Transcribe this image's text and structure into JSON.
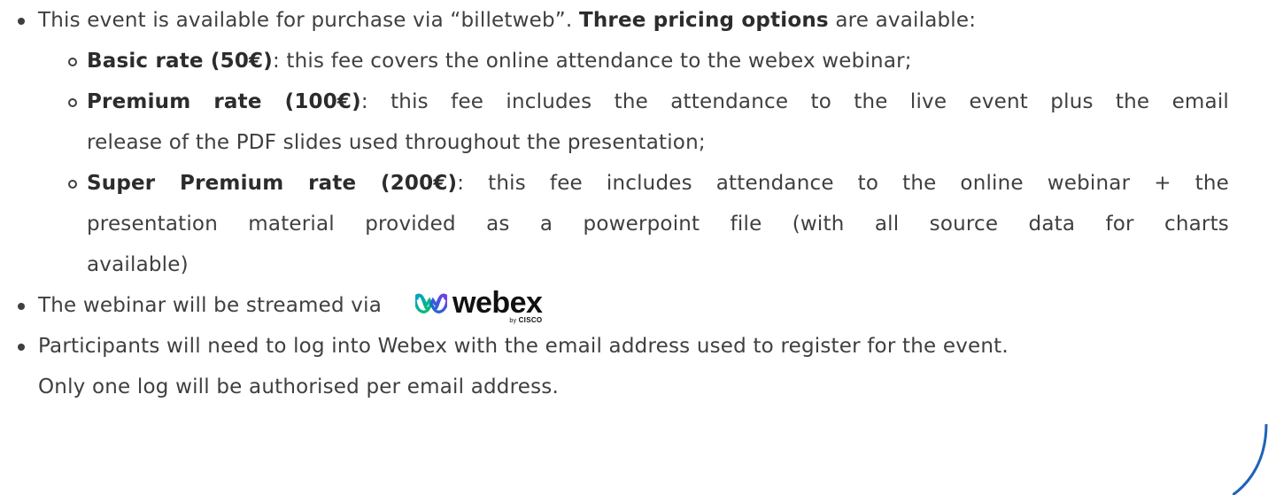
{
  "bullets": {
    "purchase": {
      "text_before": "This event is available for purchase via “billetweb”. ",
      "bold": "Three pricing options",
      "text_after": " are available:"
    },
    "options": [
      {
        "bold": "Basic rate (50€)",
        "lines": [
          ": this fee covers the online attendance to the webex webinar;"
        ]
      },
      {
        "bold": "Premium rate (100€)",
        "lines": [
          ": this fee includes the attendance to the live event plus the email",
          "release of the PDF slides used throughout the presentation;"
        ]
      },
      {
        "bold": "Super Premium rate (200€)",
        "lines": [
          ": this fee includes attendance to the online webinar + the",
          "presentation material provided as a powerpoint file (with all source data for charts",
          "available)"
        ]
      }
    ],
    "streamed": {
      "text": "The webinar will be streamed via",
      "logo": {
        "icon": "webex-logo-icon",
        "word": "webex",
        "by": "by",
        "brand": "CISCO",
        "colors": [
          "#00A0D1",
          "#07C160",
          "#1170CF",
          "#7C3AED"
        ]
      }
    },
    "login": {
      "lines": [
        "Participants will need to log into Webex with the email address used to register for the event.",
        "Only one log will be authorised per email address."
      ]
    }
  },
  "colors": {
    "text": "#3f3f3f",
    "bold": "#2c2c2c",
    "accent_arc": "#1e63b8"
  }
}
